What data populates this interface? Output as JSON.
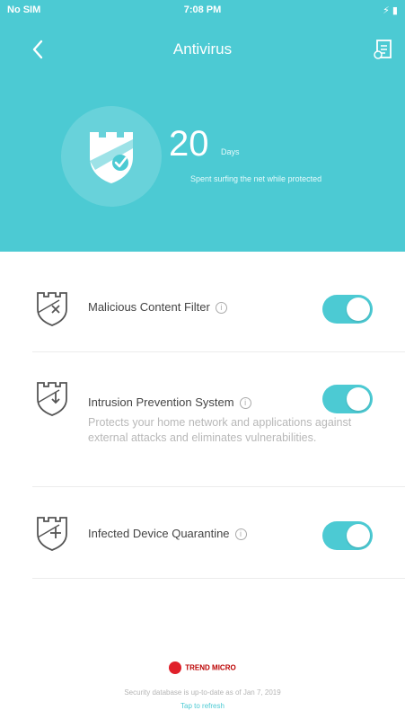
{
  "status_bar": {
    "carrier": "No SIM",
    "time": "7:08 PM",
    "battery": "⚡ ▮"
  },
  "nav": {
    "title": "Antivirus",
    "back_icon": "chevron-left-icon",
    "history_icon": "history-icon"
  },
  "summary": {
    "days": "20",
    "unit": "Days",
    "description": "Spent surfing the net while protected"
  },
  "features": [
    {
      "label": "Malicious Content Filter",
      "enabled": true,
      "icon": "shield-x-icon"
    },
    {
      "label": "Intrusion Prevention System",
      "enabled": true,
      "icon": "shield-arrow-icon",
      "description": "Protects your home network and applications against external attacks and eliminates vulnerabilities."
    },
    {
      "label": "Infected Device Quarantine",
      "enabled": true,
      "icon": "shield-plus-icon"
    }
  ],
  "footer": {
    "brand": "TREND MICRO",
    "database_status": "Security database is up-to-date as of Jan 7, 2019",
    "refresh_link": "Tap to refresh"
  },
  "colors": {
    "accent": "#4ccad3",
    "toggle_on": "#4ccad3",
    "brand_red": "#e0202a"
  }
}
